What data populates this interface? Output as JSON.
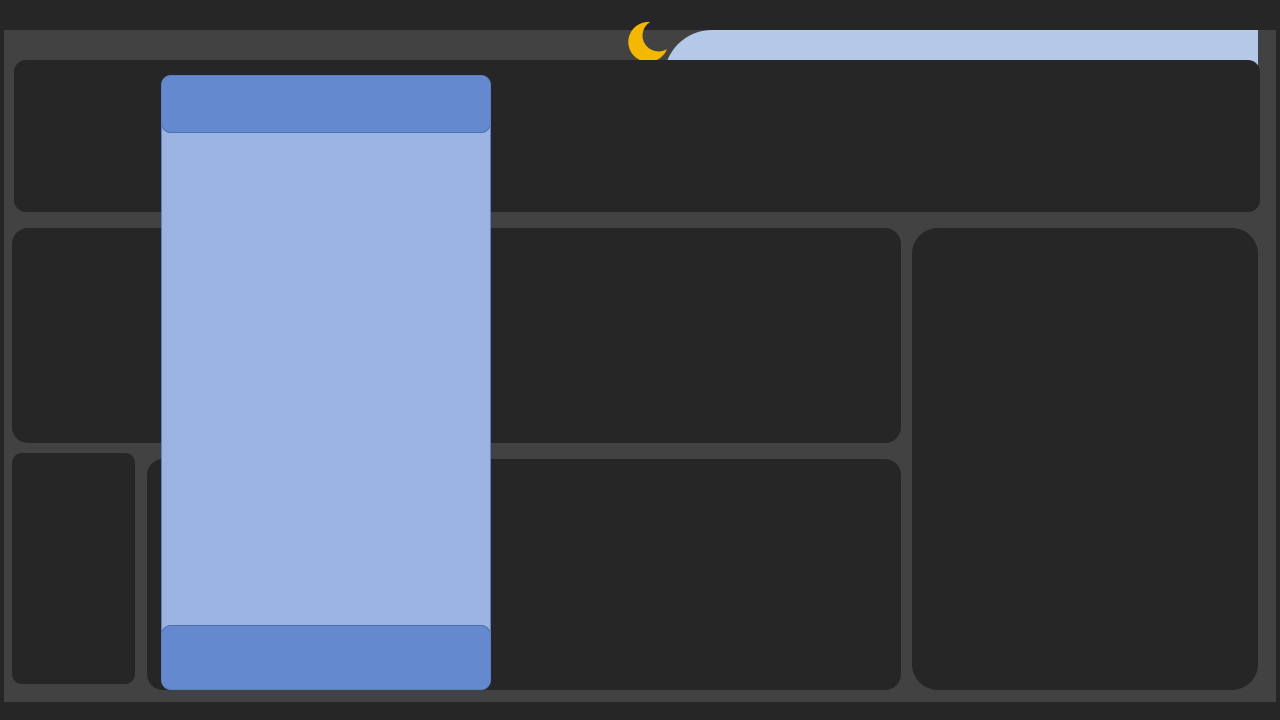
{
  "app": {
    "title": ""
  },
  "theme": {
    "background": "#262626",
    "frame": "#424242",
    "panel": "#262626",
    "accent": "#6489ce",
    "drawer": "#9bb3e1",
    "top_tab": "#b4c8e8",
    "moon": "#f5b800"
  },
  "top_bar": {
    "icon": "moon-icon"
  },
  "drawer": {
    "header_label": "",
    "footer_label": ""
  }
}
